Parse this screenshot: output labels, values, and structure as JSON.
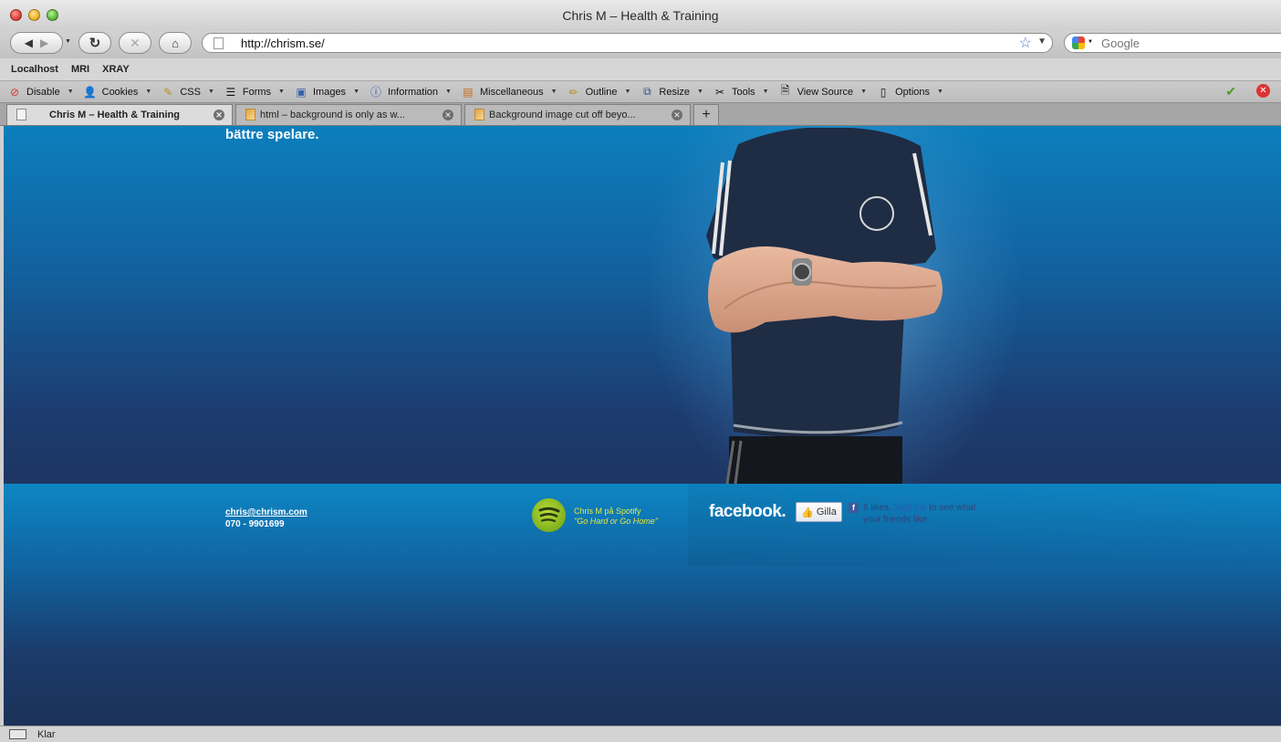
{
  "window": {
    "title": "Chris M – Health & Training"
  },
  "nav": {
    "url": "http://chrism.se/",
    "search_placeholder": "Google"
  },
  "bookmarks": [
    "Localhost",
    "MRI",
    "XRAY"
  ],
  "webdev_toolbar": [
    {
      "label": "Disable",
      "icon": "disable-icon"
    },
    {
      "label": "Cookies",
      "icon": "cookies-icon"
    },
    {
      "label": "CSS",
      "icon": "css-icon"
    },
    {
      "label": "Forms",
      "icon": "forms-icon"
    },
    {
      "label": "Images",
      "icon": "images-icon"
    },
    {
      "label": "Information",
      "icon": "information-icon"
    },
    {
      "label": "Miscellaneous",
      "icon": "miscellaneous-icon"
    },
    {
      "label": "Outline",
      "icon": "outline-icon"
    },
    {
      "label": "Resize",
      "icon": "resize-icon"
    },
    {
      "label": "Tools",
      "icon": "tools-icon"
    },
    {
      "label": "View Source",
      "icon": "view-source-icon"
    },
    {
      "label": "Options",
      "icon": "options-icon"
    }
  ],
  "tabs": [
    {
      "label": "Chris M – Health & Training",
      "active": true
    },
    {
      "label": "html – background is only as w...",
      "active": false
    },
    {
      "label": "Background image cut off beyo...",
      "active": false
    }
  ],
  "page": {
    "tagline": "bättre spelare.",
    "email": "chris@chrism.com",
    "phone": "070 - 9901699",
    "spotify_line1": "Chris M på Spotify",
    "spotify_line2": "\"Go Hard or Go Home\"",
    "facebook_logo": "facebook.",
    "like_label": "Gilla",
    "fb_text_a": "6 likes.",
    "fb_text_link": "Sign Up",
    "fb_text_b": "to see what",
    "fb_text_line2": "your friends like."
  },
  "status": {
    "text": "Klar"
  },
  "colors": {
    "accent_blue": "#0c7fbd",
    "spotify_yellow": "#e8ea3a",
    "facebook_blue": "#3b5998"
  }
}
